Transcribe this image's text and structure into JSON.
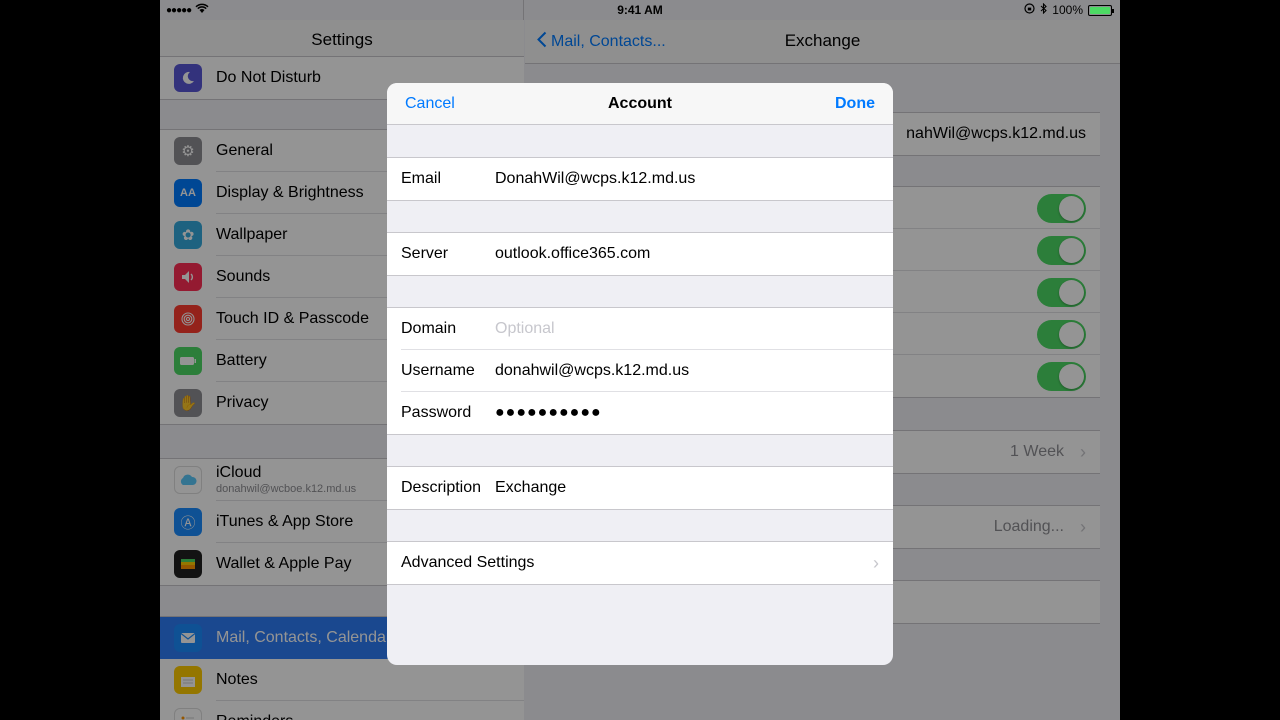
{
  "status_bar": {
    "signal": "●●●●●",
    "time": "9:41 AM",
    "battery_percent": "100%"
  },
  "master": {
    "title": "Settings",
    "items_top": [
      {
        "label": "Do Not Disturb",
        "icon": "moon-icon",
        "color": "#5856d6"
      }
    ],
    "items_general": [
      {
        "label": "General",
        "icon": "gear-icon",
        "color": "#8e8e93"
      },
      {
        "label": "Display & Brightness",
        "icon": "display-icon",
        "color": "#007aff"
      },
      {
        "label": "Wallpaper",
        "icon": "flower-icon",
        "color": "#34aadc"
      },
      {
        "label": "Sounds",
        "icon": "speaker-icon",
        "color": "#ff2d55"
      },
      {
        "label": "Touch ID & Passcode",
        "icon": "fingerprint-icon",
        "color": "#ff3b30"
      },
      {
        "label": "Battery",
        "icon": "battery-icon",
        "color": "#4cd964"
      },
      {
        "label": "Privacy",
        "icon": "hand-icon",
        "color": "#8e8e93"
      }
    ],
    "items_accounts": [
      {
        "label": "iCloud",
        "sub": "donahwil@wcboe.k12.md.us",
        "icon": "cloud-icon",
        "color": "#ffffff"
      },
      {
        "label": "iTunes & App Store",
        "icon": "appstore-icon",
        "color": "#1a8cff"
      },
      {
        "label": "Wallet & Apple Pay",
        "icon": "wallet-icon",
        "color": "#222222"
      }
    ],
    "items_apps": [
      {
        "label": "Mail, Contacts, Calendars",
        "icon": "mail-icon",
        "color": "#1a8cff"
      },
      {
        "label": "Notes",
        "icon": "notes-icon",
        "color": "#ffcc00"
      },
      {
        "label": "Reminders",
        "icon": "reminders-icon",
        "color": "#ffffff"
      }
    ]
  },
  "detail": {
    "back_label": "Mail, Contacts...",
    "title": "Exchange",
    "account_value": "nahWil@wcps.k12.md.us",
    "mail_days_value": "1 Week",
    "loading_value": "Loading..."
  },
  "modal": {
    "cancel_label": "Cancel",
    "title": "Account",
    "done_label": "Done",
    "email_label": "Email",
    "email_value": "DonahWil@wcps.k12.md.us",
    "server_label": "Server",
    "server_value": "outlook.office365.com",
    "domain_label": "Domain",
    "domain_placeholder": "Optional",
    "username_label": "Username",
    "username_value": "donahwil@wcps.k12.md.us",
    "password_label": "Password",
    "password_value": "●●●●●●●●●●",
    "description_label": "Description",
    "description_value": "Exchange",
    "advanced_label": "Advanced Settings"
  }
}
